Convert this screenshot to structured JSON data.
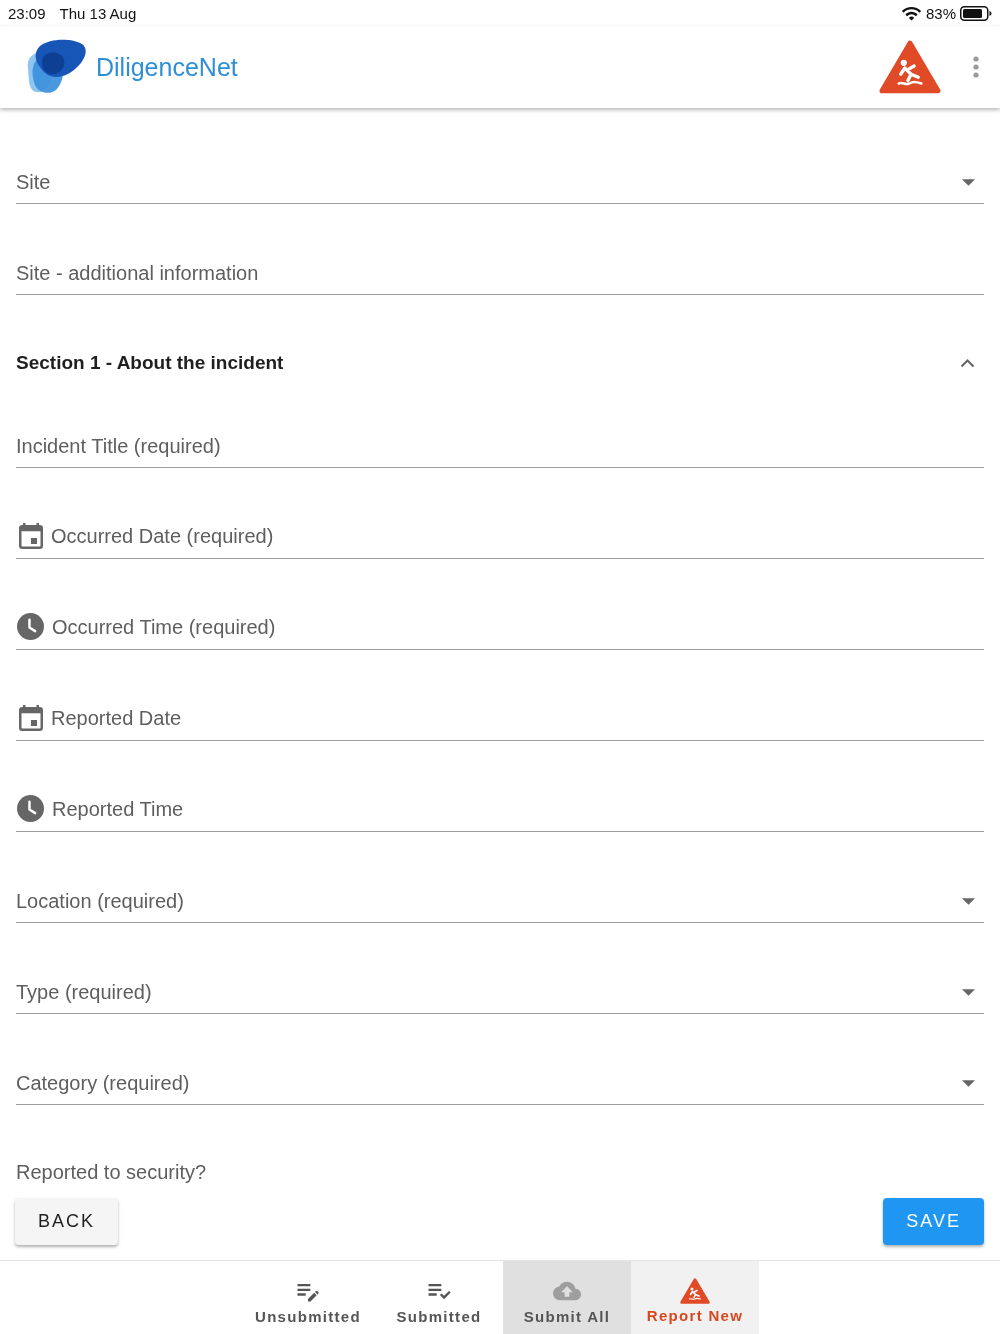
{
  "status_bar": {
    "time": "23:09",
    "date": "Thu 13 Aug",
    "battery": "83%"
  },
  "app_bar": {
    "title": "DiligenceNet"
  },
  "form": {
    "fields": [
      {
        "kind": "select",
        "placeholder": "Site"
      },
      {
        "kind": "text",
        "placeholder": "Site - additional information"
      }
    ],
    "sections": [
      {
        "title": "Section 1 - About the incident",
        "expanded": true,
        "fields": [
          {
            "kind": "text",
            "placeholder": "Incident Title (required)"
          },
          {
            "kind": "date",
            "placeholder": "Occurred Date (required)"
          },
          {
            "kind": "time",
            "placeholder": "Occurred Time (required)"
          },
          {
            "kind": "date",
            "placeholder": "Reported Date"
          },
          {
            "kind": "time",
            "placeholder": "Reported Time"
          },
          {
            "kind": "select",
            "placeholder": "Location (required)"
          },
          {
            "kind": "select",
            "placeholder": "Type (required)"
          },
          {
            "kind": "select",
            "placeholder": "Category (required)"
          },
          {
            "kind": "question",
            "label": "Reported to security?"
          }
        ]
      }
    ]
  },
  "actions": [
    {
      "kind": "secondary",
      "label": "BACK"
    },
    {
      "kind": "primary",
      "label": "SAVE"
    }
  ],
  "bottom_nav": [
    {
      "label": "Unsubmitted",
      "selected": false,
      "disabled": false
    },
    {
      "label": "Submitted",
      "selected": false,
      "disabled": false
    },
    {
      "label": "Submit All",
      "selected": false,
      "disabled": true
    },
    {
      "label": "Report New",
      "selected": true,
      "disabled": false
    }
  ]
}
